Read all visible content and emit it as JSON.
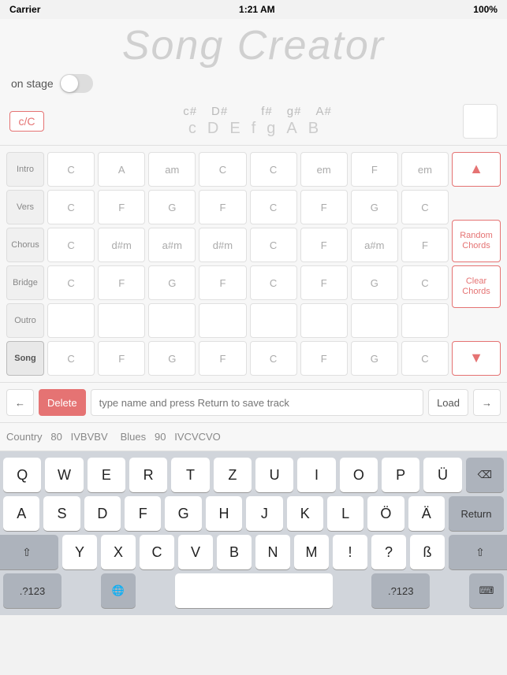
{
  "statusBar": {
    "carrier": "Carrier",
    "wifi": "▾",
    "time": "1:21 AM",
    "battery": "100%"
  },
  "appTitle": "Song Creator",
  "onStage": {
    "label": "on stage"
  },
  "chordSelector": {
    "leftBtn": "c/C",
    "sharpRow": "c#  D#       f#  g#  A#",
    "naturalRow": "c  D  E  f  g  A  B",
    "sharps": [
      "c#",
      "D#",
      "f#",
      "g#",
      "A#"
    ],
    "naturals": [
      "c",
      "D",
      "E",
      "f",
      "g",
      "A",
      "B"
    ]
  },
  "rows": [
    {
      "label": "Intro",
      "active": false
    },
    {
      "label": "Vers",
      "active": false
    },
    {
      "label": "Chorus",
      "active": false
    },
    {
      "label": "Bridge",
      "active": false
    },
    {
      "label": "Outro",
      "active": false
    },
    {
      "label": "Song",
      "active": true
    }
  ],
  "gridData": [
    [
      "C",
      "A",
      "am",
      "C",
      "C",
      "em",
      "F",
      "em"
    ],
    [
      "C",
      "F",
      "G",
      "F",
      "C",
      "F",
      "G",
      "C"
    ],
    [
      "C",
      "d#m",
      "a#m",
      "d#m",
      "C",
      "F",
      "a#m",
      "F"
    ],
    [
      "C",
      "F",
      "G",
      "F",
      "C",
      "F",
      "G",
      "C"
    ],
    [
      "",
      "",
      "",
      "",
      "",
      "",
      "",
      ""
    ],
    [
      "C",
      "F",
      "G",
      "F",
      "C",
      "F",
      "G",
      "C"
    ]
  ],
  "controls": {
    "upArrow": "▲",
    "randomChords": "Random\nChords",
    "clearChords": "Clear\nChords",
    "downArrow": "▼"
  },
  "trackBar": {
    "backBtn": "←",
    "deleteBtn": "Delete",
    "placeholder": "type name and press Return to save track",
    "loadBtn": "Load",
    "forwardBtn": "→"
  },
  "trackPreview": [
    {
      "name": "Country",
      "bpm": "80",
      "chords": "IVBVBV"
    },
    {
      "name": "Blues",
      "bpm": "90",
      "chords": "IVCVCVO"
    }
  ],
  "keyboard": {
    "row1": [
      "Q",
      "W",
      "E",
      "R",
      "T",
      "Z",
      "U",
      "I",
      "O",
      "P",
      "Ü"
    ],
    "row2": [
      "A",
      "S",
      "D",
      "F",
      "G",
      "H",
      "J",
      "K",
      "L",
      "Ö",
      "Ä"
    ],
    "row3": [
      "Y",
      "X",
      "C",
      "V",
      "B",
      "N",
      "M",
      "!",
      "?",
      "ß"
    ],
    "bottomLeft": ".?123",
    "globe": "🌐",
    "space": "",
    "bottomRight": ".?123",
    "keyboard": "⌨"
  }
}
